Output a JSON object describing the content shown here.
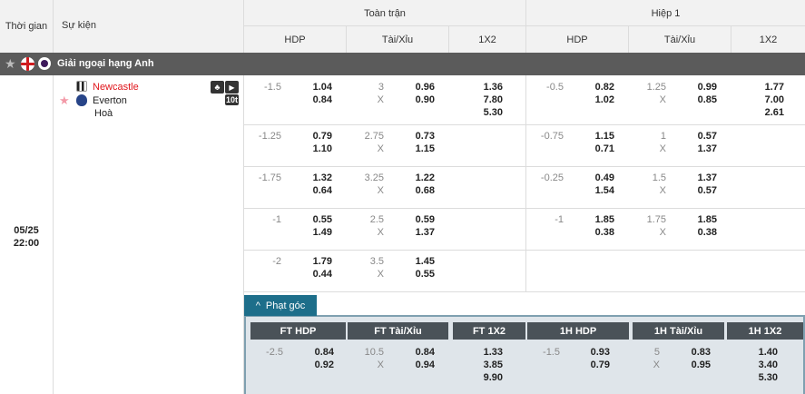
{
  "header": {
    "col_time": "Thời gian",
    "col_event": "Sự kiện",
    "full_time": "Toàn trận",
    "half1": "Hiệp 1",
    "hdp": "HDP",
    "taixiu": "Tài/Xỉu",
    "x12": "1X2"
  },
  "league": {
    "name": "Giải ngoại hạng Anh"
  },
  "match": {
    "date": "05/25",
    "time": "22:00",
    "home": "Newcastle",
    "away": "Everton",
    "draw": "Hoà",
    "live_badge": "10t"
  },
  "rows": [
    {
      "ft_hc": "-1.5",
      "ft_h1": "1.04",
      "ft_h2": "0.84",
      "ft_ou": "3",
      "ft_x": "X",
      "ft_o1": "0.96",
      "ft_o2": "0.90",
      "ft_1x2": [
        "1.36",
        "7.80",
        "5.30"
      ],
      "h1_hc": "-0.5",
      "h1_h1": "0.82",
      "h1_h2": "1.02",
      "h1_ou": "1.25",
      "h1_x": "X",
      "h1_o1": "0.99",
      "h1_o2": "0.85",
      "h1_1x2": [
        "1.77",
        "7.00",
        "2.61"
      ]
    },
    {
      "ft_hc": "-1.25",
      "ft_h1": "0.79",
      "ft_h2": "1.10",
      "ft_ou": "2.75",
      "ft_x": "X",
      "ft_o1": "0.73",
      "ft_o2": "1.15",
      "h1_hc": "-0.75",
      "h1_h1": "1.15",
      "h1_h2": "0.71",
      "h1_ou": "1",
      "h1_x": "X",
      "h1_o1": "0.57",
      "h1_o2": "1.37"
    },
    {
      "ft_hc": "-1.75",
      "ft_h1": "1.32",
      "ft_h2": "0.64",
      "ft_ou": "3.25",
      "ft_x": "X",
      "ft_o1": "1.22",
      "ft_o2": "0.68",
      "h1_hc": "-0.25",
      "h1_h1": "0.49",
      "h1_h2": "1.54",
      "h1_ou": "1.5",
      "h1_x": "X",
      "h1_o1": "1.37",
      "h1_o2": "0.57"
    },
    {
      "ft_hc": "-1",
      "ft_h1": "0.55",
      "ft_h2": "1.49",
      "ft_ou": "2.5",
      "ft_x": "X",
      "ft_o1": "0.59",
      "ft_o2": "1.37",
      "h1_hc": "-1",
      "h1_h1": "1.85",
      "h1_h2": "0.38",
      "h1_ou": "1.75",
      "h1_x": "X",
      "h1_o1": "1.85",
      "h1_o2": "0.38"
    },
    {
      "ft_hc": "-2",
      "ft_h1": "1.79",
      "ft_h2": "0.44",
      "ft_ou": "3.5",
      "ft_x": "X",
      "ft_o1": "1.45",
      "ft_o2": "0.55"
    }
  ],
  "corner": {
    "tab_label": "Phạt góc",
    "heads": [
      "FT HDP",
      "FT Tài/Xỉu",
      "FT 1X2",
      "1H HDP",
      "1H Tài/Xỉu",
      "1H 1X2"
    ],
    "row": {
      "ft_hc": "-2.5",
      "ft_h1": "0.84",
      "ft_h2": "0.92",
      "ft_ou": "10.5",
      "ft_x": "X",
      "ft_o1": "0.84",
      "ft_o2": "0.94",
      "ft_1x2": [
        "1.33",
        "3.85",
        "9.90"
      ],
      "h1_hc": "-1.5",
      "h1_h1": "0.93",
      "h1_h2": "0.79",
      "h1_ou": "5",
      "h1_x": "X",
      "h1_o1": "0.83",
      "h1_o2": "0.95",
      "h1_1x2": [
        "1.40",
        "3.40",
        "5.30"
      ]
    }
  },
  "colors": {
    "home_team": "#e0151b",
    "league_bar": "#5b5b5b",
    "corner_tab": "#1d6e8a",
    "star": "#f39aa8"
  }
}
